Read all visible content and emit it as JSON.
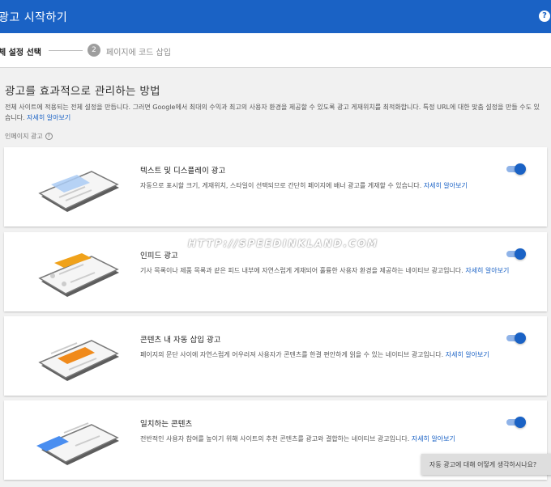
{
  "header": {
    "title": "광고 시작하기",
    "help_glyph": "?"
  },
  "steps": {
    "step1_label": "체 설정 선택",
    "step2_number": "2",
    "step2_label": "페이지에 코드 삽입"
  },
  "main": {
    "heading": "광고를 효과적으로 관리하는 방법",
    "description": "전체 사이트에 적용되는 전체 설정을 만듭니다. 그러면 Google에서 최대의 수익과 최고의 사용자 환경을 제공할 수 있도록 광고 게재위치를 최적화합니다. 특정 URL에 대한 맞춤 설정을 만들 수도 있습니다.",
    "description_link": "자세히 알아보기",
    "section_label": "인페이지 광고"
  },
  "cards": [
    {
      "title": "텍스트 및 디스플레이 광고",
      "description": "자동으로 표시할 크기, 게재위치, 스타일이 선택되므로 간단히 페이지에 배너 광고를 게재할 수 있습니다.",
      "link": "자세히 알아보기",
      "enabled": true,
      "accent": "#aacbf5"
    },
    {
      "title": "인피드 광고",
      "description": "기사 목록이나 제품 목록과 같은 피드 내부에 자연스럽게 게재되어 훌륭한 사용자 환경을 제공하는 네이티브 광고입니다.",
      "link": "자세히 알아보기",
      "enabled": true,
      "accent": "#f0a21b"
    },
    {
      "title": "콘텐츠 내 자동 삽입 광고",
      "description": "페이지의 문단 사이에 자연스럽게 어우러져 사용자가 콘텐츠를 한결 편안하게 읽을 수 있는 네이티브 광고입니다.",
      "link": "자세히 알아보기",
      "enabled": true,
      "accent": "#f08a1b"
    },
    {
      "title": "일치하는 콘텐츠",
      "description": "전반적인 사용자 참여를 높이기 위해 사이트의 추천 콘텐츠를 광고와 결합하는 네이티브 광고입니다.",
      "link": "자세히 알아보기",
      "enabled": true,
      "accent": "#4a8ef0"
    }
  ],
  "watermark": "HTTP://SPEEDINKLAND.COM",
  "feedback": {
    "label": "자동 광고에 대해 어떻게 생각하시나요?"
  },
  "colors": {
    "brand_blue": "#1a62c5",
    "toggle_track": "#8fb3e8",
    "page_bg": "#f1f1f1"
  }
}
